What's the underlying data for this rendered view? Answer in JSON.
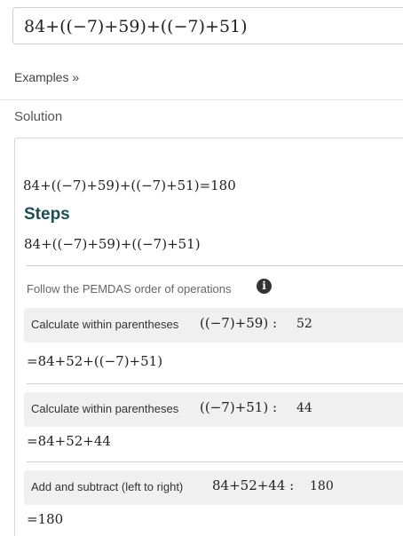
{
  "input": {
    "expression": "84+((−7)+59)+((−7)+51)"
  },
  "examples_link": "Examples »",
  "solution_heading": "Solution",
  "solution": {
    "result": "84+((−7)+59)+((−7)+51)=180",
    "steps_title": "Steps",
    "steps_expression": "84+((−7)+59)+((−7)+51)",
    "pemdas_note": "Follow the PEMDAS order of operations",
    "info_icon": "i",
    "steps": [
      {
        "label": "Calculate within parentheses",
        "math": "((−7)+59) :",
        "result": "52",
        "output": "=84+52+((−7)+51)"
      },
      {
        "label": "Calculate within parentheses",
        "math": "((−7)+51) :",
        "result": "44",
        "output": "=84+52+44"
      },
      {
        "label": "Add and subtract (left to right)",
        "math": "84+52+44 :",
        "result": "180",
        "output": "=180"
      }
    ]
  }
}
